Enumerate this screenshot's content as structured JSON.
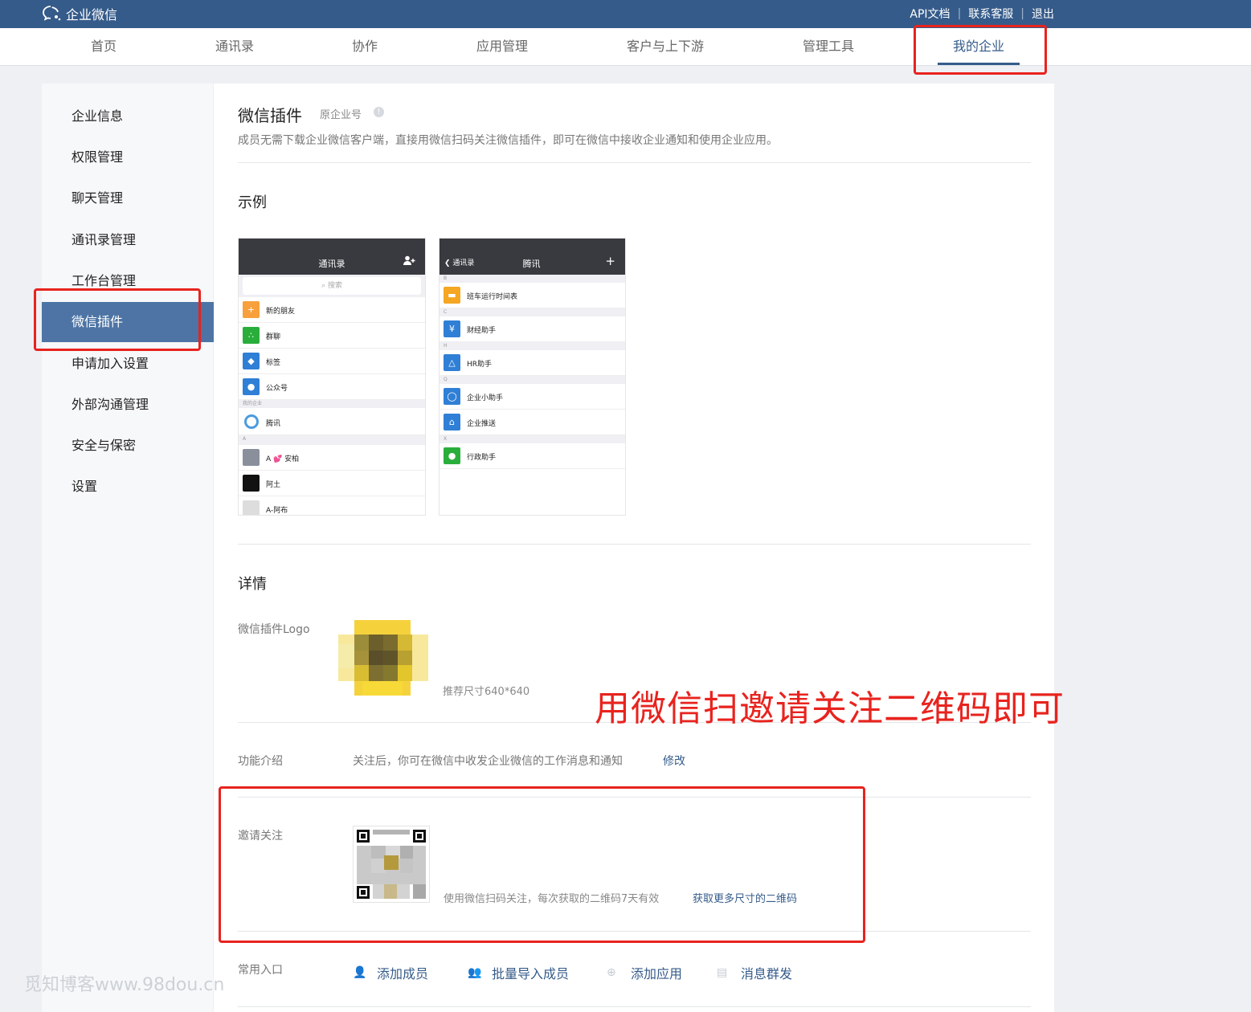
{
  "topbar": {
    "brand": "企业微信",
    "links": [
      "API文档",
      "联系客服",
      "退出"
    ],
    "separator": "|"
  },
  "nav": {
    "items": [
      "首页",
      "通讯录",
      "协作",
      "应用管理",
      "客户与上下游",
      "管理工具",
      "我的企业"
    ],
    "active": "我的企业"
  },
  "sidebar": {
    "items": [
      "企业信息",
      "权限管理",
      "聊天管理",
      "通讯录管理",
      "工作台管理",
      "微信插件",
      "申请加入设置",
      "外部沟通管理",
      "安全与保密",
      "设置"
    ],
    "active": "微信插件"
  },
  "main": {
    "title": "微信插件",
    "subtitle": "原企业号",
    "help_icon": "!",
    "description": "成员无需下载企业微信客户端，直接用微信扫码关注微信插件，即可在微信中接收企业通知和使用企业应用。",
    "example_heading": "示例",
    "details_heading": "详情"
  },
  "phone1": {
    "title": "通讯录",
    "action_icon": "add-friend-icon",
    "search_placeholder": "搜索",
    "rows": [
      {
        "label": "新的朋友",
        "icon": "new-friends-icon",
        "color": "#f7a03c",
        "glyph": "👤"
      },
      {
        "label": "群聊",
        "icon": "group-chat-icon",
        "color": "#2aae3b",
        "glyph": "👥"
      },
      {
        "label": "标签",
        "icon": "tag-icon",
        "color": "#2f7fd6",
        "glyph": "🏷"
      },
      {
        "label": "公众号",
        "icon": "official-account-icon",
        "color": "#2f7fd6",
        "glyph": "👤"
      }
    ],
    "group_my_company": "我的企业",
    "company_row": {
      "label": "腾讯",
      "icon": "tencent-logo-icon"
    },
    "group_a": "A",
    "a_rows": [
      {
        "label": "A 💕 安柏",
        "icon": "avatar-icon"
      },
      {
        "label": "阿土",
        "icon": "avatar-icon"
      },
      {
        "label": "A-阿布",
        "icon": "avatar-icon"
      }
    ]
  },
  "phone2": {
    "title": "腾讯",
    "back_label": "通讯录",
    "action_icon": "plus-icon",
    "sections": [
      {
        "letter": "B",
        "items": [
          {
            "label": "班车运行时间表",
            "icon": "bus-icon",
            "color": "#f5a623",
            "glyph": "🚌"
          }
        ]
      },
      {
        "letter": "C",
        "items": [
          {
            "label": "财经助手",
            "icon": "yen-icon",
            "color": "#2f7fd6",
            "glyph": "¥"
          }
        ]
      },
      {
        "letter": "H",
        "items": [
          {
            "label": "HR助手",
            "icon": "hr-icon",
            "color": "#2f7fd6",
            "glyph": "⚇"
          }
        ]
      },
      {
        "letter": "Q",
        "items": [
          {
            "label": "企业小助手",
            "icon": "chat-bubble-icon",
            "color": "#2f7fd6",
            "glyph": "◔"
          },
          {
            "label": "企业推送",
            "icon": "home-icon",
            "color": "#2f7fd6",
            "glyph": "⌂"
          }
        ]
      },
      {
        "letter": "X",
        "items": [
          {
            "label": "行政助手",
            "icon": "admin-icon",
            "color": "#2aae3b",
            "glyph": "👤"
          }
        ]
      }
    ]
  },
  "details": {
    "logo_label": "微信插件Logo",
    "logo_hint": "推荐尺寸640*640",
    "intro_label": "功能介绍",
    "intro_value": "关注后，你可在微信中收发企业微信的工作消息和通知",
    "intro_edit": "修改",
    "invite_label": "邀请关注",
    "invite_hint": "使用微信扫码关注，每次获取的二维码7天有效",
    "invite_more": "获取更多尺寸的二维码",
    "entry_label": "常用入口",
    "entries": [
      {
        "label": "添加成员",
        "icon": "add-member-icon"
      },
      {
        "label": "批量导入成员",
        "icon": "import-members-icon"
      },
      {
        "label": "添加应用",
        "icon": "add-app-icon"
      },
      {
        "label": "消息群发",
        "icon": "broadcast-message-icon"
      }
    ]
  },
  "annotation": "用微信扫邀请关注二维码即可",
  "watermark": "觅知博客www.98dou.cn",
  "colors": {
    "brand": "#355b8a",
    "active_side": "#4d74a4",
    "annotation": "#e8231e"
  }
}
